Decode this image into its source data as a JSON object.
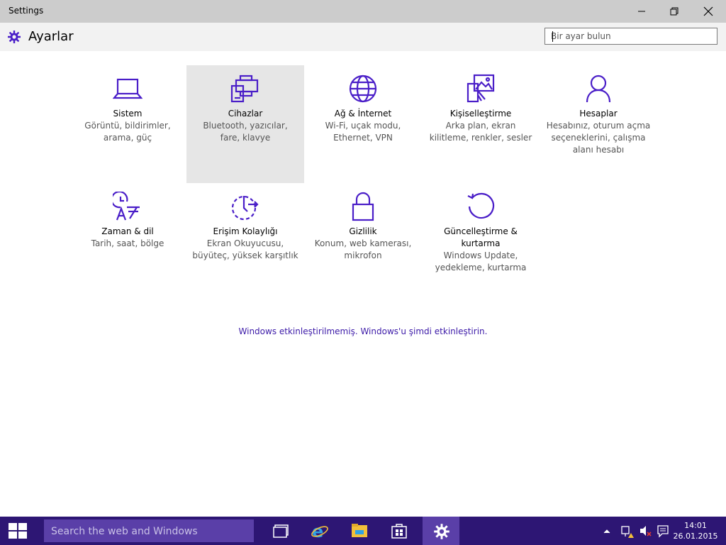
{
  "window": {
    "title": "Settings"
  },
  "header": {
    "title": "Ayarlar",
    "search_placeholder": "Bir ayar bulun"
  },
  "tiles": [
    {
      "name": "Sistem",
      "desc": [
        "Görüntü, bildirimler,",
        "arama, güç"
      ],
      "icon": "laptop-icon"
    },
    {
      "name": "Cihazlar",
      "desc": [
        "Bluetooth, yazıcılar,",
        "fare, klavye"
      ],
      "icon": "devices-icon",
      "selected": true
    },
    {
      "name": "Ağ & İnternet",
      "desc": [
        "Wi-Fi, uçak modu,",
        "Ethernet, VPN"
      ],
      "icon": "globe-icon"
    },
    {
      "name": "Kişiselleştirme",
      "desc": [
        "Arka plan, ekran",
        "kilitleme, renkler, sesler"
      ],
      "icon": "personalization-icon"
    },
    {
      "name": "Hesaplar",
      "desc": [
        "Hesabınız, oturum açma",
        "seçeneklerini, çalışma",
        "alanı hesabı"
      ],
      "icon": "person-icon"
    },
    {
      "name": "Zaman & dil",
      "desc": [
        "Tarih, saat, bölge"
      ],
      "icon": "time-language-icon"
    },
    {
      "name": "Erişim Kolaylığı",
      "desc": [
        "Ekran Okuyucusu,",
        "büyüteç, yüksek karşıtlık"
      ],
      "icon": "ease-of-access-icon"
    },
    {
      "name": "Gizlilik",
      "desc": [
        "Konum, web kamerası,",
        "mikrofon"
      ],
      "icon": "lock-icon"
    },
    {
      "name": "Güncelleştirme &",
      "name2": "kurtarma",
      "desc": [
        "Windows Update,",
        "yedekleme, kurtarma"
      ],
      "icon": "update-icon"
    }
  ],
  "activation_text": "Windows etkinleştirilmemiş. Windows'u şimdi etkinleştirin.",
  "taskbar": {
    "search_placeholder": "Search the web and Windows",
    "clock_time": "14:01",
    "clock_date": "26.01.2015"
  },
  "colors": {
    "accent": "#4a1ec8",
    "taskbar": "#2d1674",
    "taskbar_active": "#5a3fa8",
    "link": "#3c1aa8"
  }
}
